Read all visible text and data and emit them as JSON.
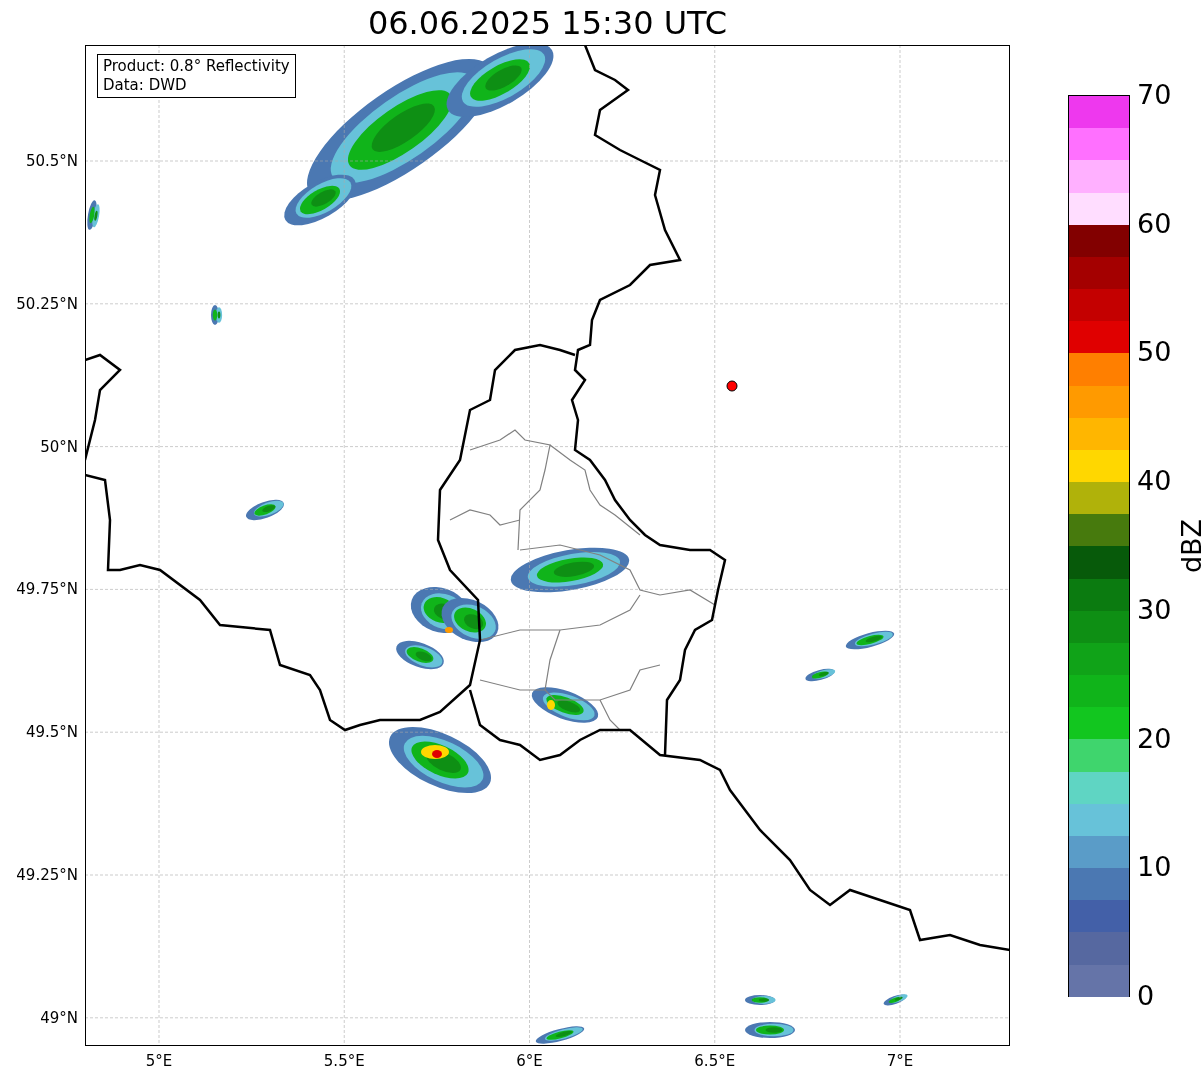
{
  "title": "06.06.2025 15:30 UTC",
  "info_box": [
    "Product: 0.8° Reflectivity",
    "Data: DWD"
  ],
  "map": {
    "xticks": [
      "5°E",
      "5.5°E",
      "6°E",
      "6.5°E",
      "7°E"
    ],
    "yticks": [
      "50.5°N",
      "50.25°N",
      "50°N",
      "49.75°N",
      "49.5°N",
      "49.25°N",
      "49°N"
    ]
  },
  "colorbar": {
    "label": "dBZ",
    "ticks": [
      "70",
      "60",
      "50",
      "40",
      "30",
      "20",
      "10",
      "0"
    ],
    "segments": [
      {
        "color": "#ee38ee"
      },
      {
        "color": "#ff70ff"
      },
      {
        "color": "#ffb0ff"
      },
      {
        "color": "#ffddff"
      },
      {
        "color": "#820000"
      },
      {
        "color": "#a40000"
      },
      {
        "color": "#c40000"
      },
      {
        "color": "#e00000"
      },
      {
        "color": "#ff7f00"
      },
      {
        "color": "#ff9a00"
      },
      {
        "color": "#ffb600"
      },
      {
        "color": "#ffd700"
      },
      {
        "color": "#b0b20a"
      },
      {
        "color": "#477a0d"
      },
      {
        "color": "#075a0a"
      },
      {
        "color": "#0b7b10"
      },
      {
        "color": "#0e8f14"
      },
      {
        "color": "#10a318"
      },
      {
        "color": "#10b41a"
      },
      {
        "color": "#12c61f"
      },
      {
        "color": "#3fd56d"
      },
      {
        "color": "#5fd5c3"
      },
      {
        "color": "#67c2d9"
      },
      {
        "color": "#5a9cc8"
      },
      {
        "color": "#4b78b2"
      },
      {
        "color": "#4360a8"
      },
      {
        "color": "#5668a0"
      },
      {
        "color": "#6574a8"
      }
    ]
  }
}
